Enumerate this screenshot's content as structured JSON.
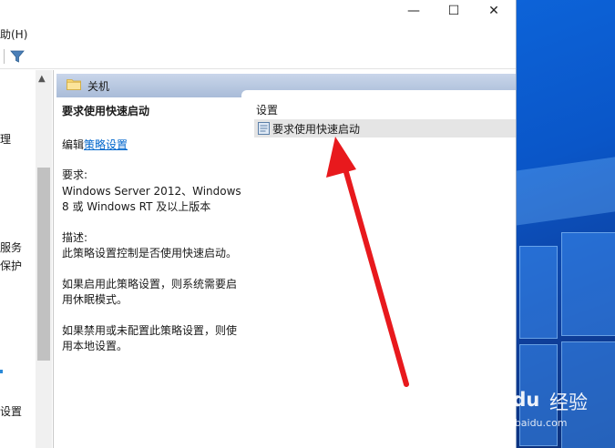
{
  "menubar": {
    "help_label": "助(H)"
  },
  "window_controls": {
    "minimize": "—",
    "maximize": "☐",
    "close": "✕"
  },
  "tree": {
    "items": [
      {
        "label": "理"
      },
      {
        "label": "服务"
      },
      {
        "label": "保护"
      },
      {
        "label": "设置"
      }
    ]
  },
  "header": {
    "title": "关机"
  },
  "description": {
    "title": "要求使用快速启动",
    "edit_prefix": "编辑",
    "edit_link": "策略设置",
    "requirements_label": "要求:",
    "requirements_line1": "Windows Server 2012、Windows",
    "requirements_line2": "8 或 Windows RT 及以上版本",
    "description_label": "描述:",
    "description_text": "此策略设置控制是否使用快速启动。",
    "enabled_line1": "如果启用此策略设置，则系统需要启",
    "enabled_line2": "用休眠模式。",
    "disabled_line1": "如果禁用或未配置此策略设置，则使",
    "disabled_line2": "用本地设置。"
  },
  "settings_list": {
    "column_header": "设置",
    "rows": [
      {
        "label": "要求使用快速启动"
      }
    ]
  },
  "watermark": {
    "brand": "Baidu",
    "product": "经验",
    "url": "jingyan.baidu.com"
  },
  "colors": {
    "header_bar": "#b9c9e2",
    "link": "#0066cc",
    "arrow": "#e8191d",
    "desktop": "#0a56c8"
  }
}
